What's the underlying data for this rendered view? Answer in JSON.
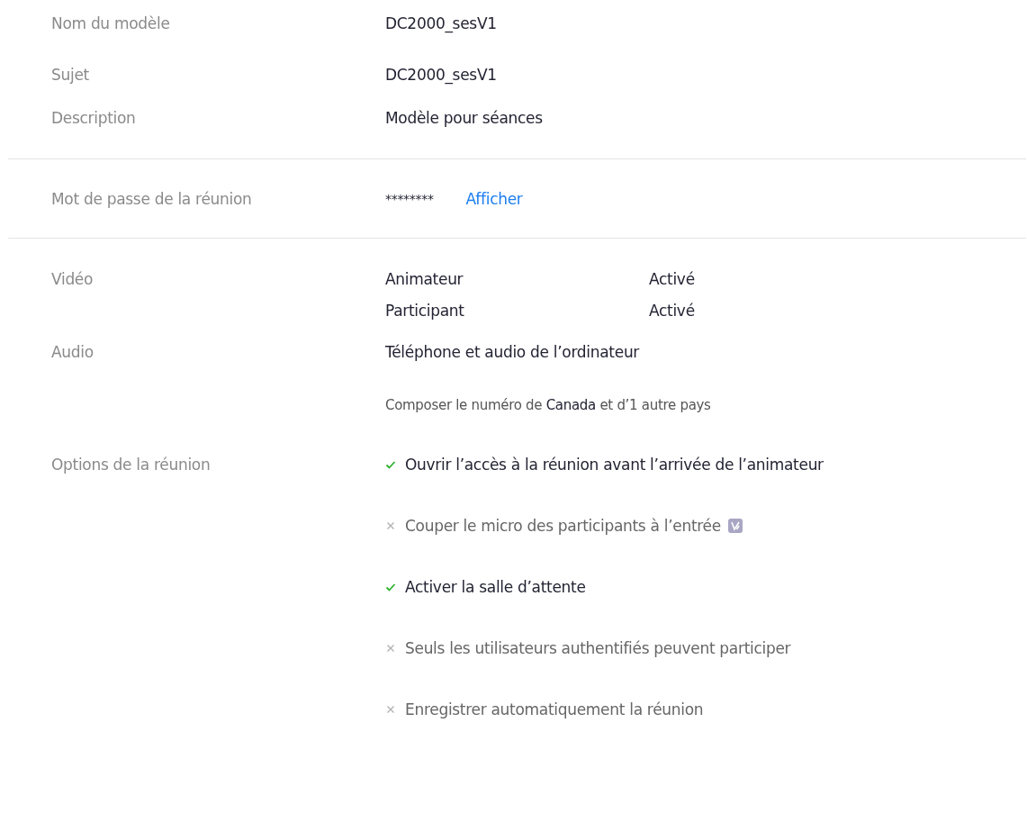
{
  "info": [
    {
      "label": "Nom du modèle",
      "value": "DC2000_sesV1"
    },
    {
      "label": "Sujet",
      "value": "DC2000_sesV1"
    },
    {
      "label": "Description",
      "value": "Modèle pour séances"
    }
  ],
  "password": {
    "label": "Mot de passe de la réunion",
    "value": "********",
    "link": "Afficher"
  },
  "video": {
    "label": "Vidéo",
    "rows": [
      {
        "role": "Animateur",
        "status": "Activé"
      },
      {
        "role": "Participant",
        "status": "Activé"
      }
    ]
  },
  "audio": {
    "label": "Audio",
    "value": "Téléphone et audio de l’ordinateur",
    "note": "Composer le numéro de **Canada** et d’1 autre pays"
  },
  "options": {
    "label": "Options de la réunion",
    "items": [
      {
        "text": "Ouvrir l’accès à la réunion avant l’arrivée de l’animateur",
        "enabled": true,
        "badge": false
      },
      {
        "text": "Couper le micro des participants à l’entrée",
        "enabled": false,
        "badge": true
      },
      {
        "text": "Activer la salle d’attente",
        "enabled": true,
        "badge": false
      },
      {
        "text": "Seuls les utilisateurs authentifiés peuvent participer",
        "enabled": false,
        "badge": false
      },
      {
        "text": "Enregistrer automatiquement la réunion",
        "enabled": false,
        "badge": false
      }
    ]
  }
}
